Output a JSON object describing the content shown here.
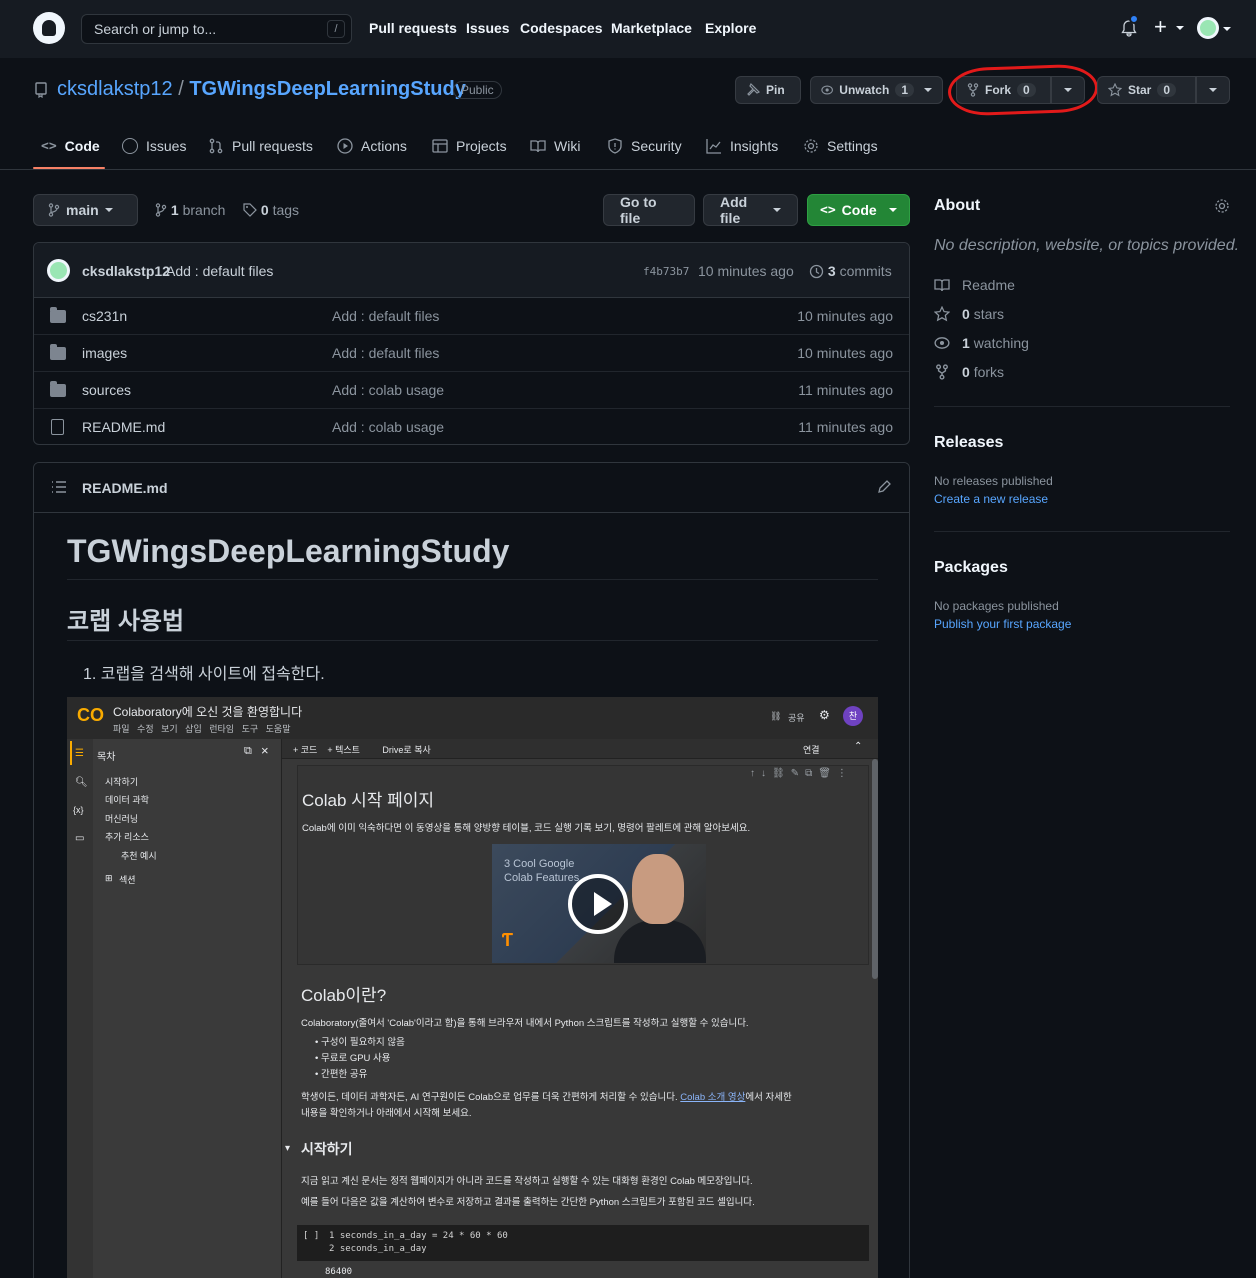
{
  "header": {
    "search_placeholder": "Search or jump to...",
    "search_hint": "/",
    "nav": [
      "Pull requests",
      "Issues",
      "Codespaces",
      "Marketplace",
      "Explore"
    ],
    "plus": "+"
  },
  "repo": {
    "owner": "cksdlakstp12",
    "separator": "/",
    "name": "TGWingsDeepLearningStudy",
    "visibility": "Public",
    "pin_label": "Pin",
    "unwatch_label": "Unwatch",
    "watch_count": "1",
    "fork_label": "Fork",
    "fork_count": "0",
    "star_label": "Star",
    "star_count": "0"
  },
  "tabs": [
    {
      "label": "Code",
      "icon": "code-icon"
    },
    {
      "label": "Issues",
      "icon": "issue-icon"
    },
    {
      "label": "Pull requests",
      "icon": "pull-request-icon"
    },
    {
      "label": "Actions",
      "icon": "play-icon"
    },
    {
      "label": "Projects",
      "icon": "table-icon"
    },
    {
      "label": "Wiki",
      "icon": "book-icon"
    },
    {
      "label": "Security",
      "icon": "shield-icon"
    },
    {
      "label": "Insights",
      "icon": "graph-icon"
    },
    {
      "label": "Settings",
      "icon": "gear-icon"
    }
  ],
  "browser": {
    "branch": "main",
    "branch_count": "1",
    "branch_label": "branch",
    "tag_count": "0",
    "tag_label": "tags",
    "go_to_file": "Go to file",
    "add_file": "Add file",
    "code": "Code"
  },
  "latest_commit": {
    "author": "cksdlakstp12",
    "message": "Add : default files",
    "hash": "f4b73b7",
    "time": "10 minutes ago",
    "commit_count": "3",
    "commit_label": "commits"
  },
  "files": [
    {
      "name": "cs231n",
      "type": "folder",
      "message": "Add : default files",
      "age": "10 minutes ago"
    },
    {
      "name": "images",
      "type": "folder",
      "message": "Add : default files",
      "age": "10 minutes ago"
    },
    {
      "name": "sources",
      "type": "folder",
      "message": "Add : colab usage",
      "age": "11 minutes ago"
    },
    {
      "name": "README.md",
      "type": "file",
      "message": "Add : colab usage",
      "age": "11 minutes ago"
    }
  ],
  "readme": {
    "filename": "README.md",
    "h1": "TGWingsDeepLearningStudy",
    "h2": "코랩 사용법",
    "step1": "1. 코랩을 검색해 사이트에 접속한다."
  },
  "colab": {
    "logo": "CO",
    "title": "Colaboratory에 오신 것을 환영합니다",
    "menu": "파일   수정   보기   삽입   런타임   도구   도움말",
    "share": "공유",
    "user_initial": "찬",
    "toolbar": "+ 코드    + 텍스트         Drive로 복사",
    "connect": "연결",
    "toc_title": "목차",
    "toc": [
      "시작하기",
      "데이터 과학",
      "머신러닝",
      "추가 리소스",
      "추천 예시"
    ],
    "section": "섹션",
    "cell1_title": "Colab 시작 페이지",
    "cell1_text": "Colab에 이미 익숙하다면 이 동영상을 통해 양방향 테이블, 코드 실행 기록 보기, 명령어 팔레트에 관해 알아보세요.",
    "video_caption_1": "3 Cool Google",
    "video_caption_2": "Colab Features",
    "h_what": "Colab이란?",
    "what_text": "Colaboratory(줄여서 'Colab'이라고 함)을 통해 브라우저 내에서 Python 스크립트를 작성하고 실행할 수 있습니다.",
    "bullets": [
      "구성이 필요하지 않음",
      "무료로 GPU 사용",
      "간편한 공유"
    ],
    "para_1": "학생이든, 데이터 과학자든, AI 연구원이든 Colab으로 업무를 더욱 간편하게 처리할 수 있습니다. ",
    "para_link": "Colab 소개 영상",
    "para_2": "에서 자세한",
    "para_3": "내용을 확인하거나 아래에서 시작해 보세요.",
    "h_start": "시작하기",
    "start_1": "지금 읽고 계신 문서는 정적 웹페이지가 아니라 코드를 작성하고 실행할 수 있는 대화형 환경인 Colab 메모장입니다.",
    "start_2": "예를 들어 다음은 값을 계산하여 변수로 저장하고 결과를 출력하는 간단한 Python 스크립트가 포함된 코드 셀입니다.",
    "code_bracket": "[ ]",
    "code_line1": "1 seconds_in_a_day = 24 * 60 * 60",
    "code_line2": "2 seconds_in_a_day",
    "output": "86400"
  },
  "about": {
    "title": "About",
    "description": "No description, website, or topics provided.",
    "readme": "Readme",
    "stars_count": "0",
    "stars_label": "stars",
    "watching_count": "1",
    "watching_label": "watching",
    "forks_count": "0",
    "forks_label": "forks"
  },
  "releases": {
    "title": "Releases",
    "none": "No releases published",
    "create": "Create a new release"
  },
  "packages": {
    "title": "Packages",
    "none": "No packages published",
    "publish": "Publish your first package"
  },
  "colors": {
    "bg": "#0d1117",
    "header_bg": "#161b22",
    "link": "#58a6ff",
    "green_button": "#238636",
    "tab_underline": "#f78166",
    "annotation": "#e21a1a"
  }
}
